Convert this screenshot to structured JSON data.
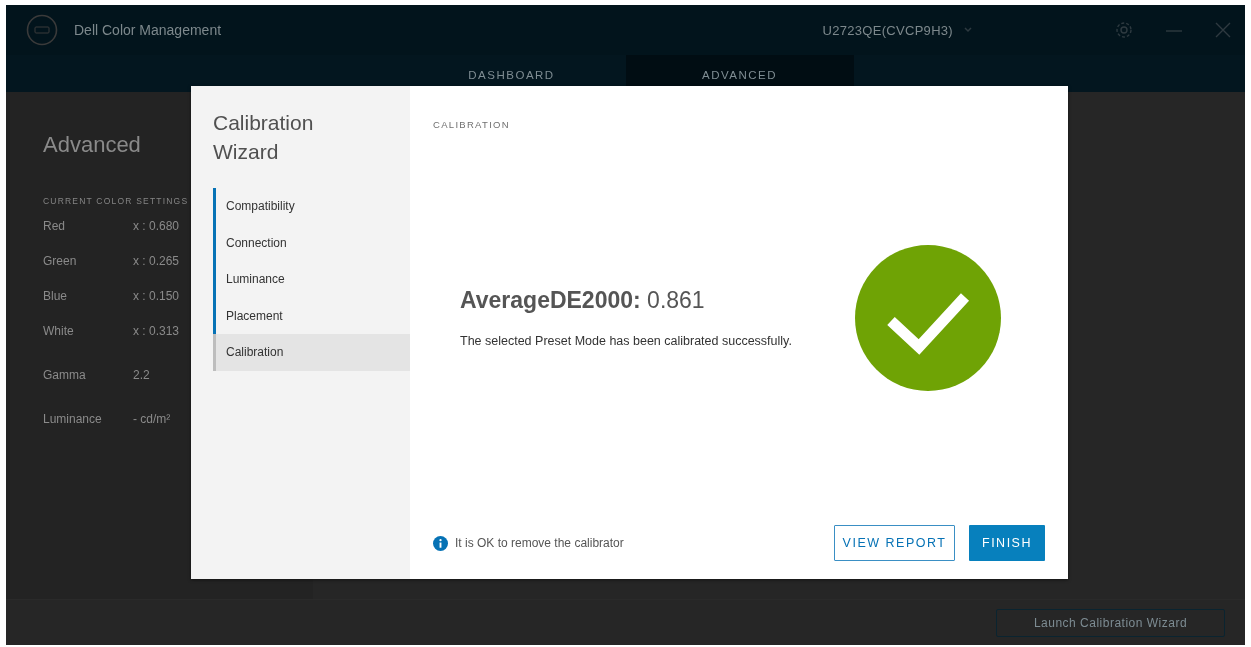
{
  "window": {
    "title": "Dell Color Management",
    "monitor": "U2723QE(CVCP9H3)"
  },
  "tabs": [
    {
      "label": "DASHBOARD",
      "selected": false
    },
    {
      "label": "ADVANCED",
      "selected": true
    }
  ],
  "advanced": {
    "title": "Advanced",
    "section": "CURRENT COLOR SETTINGS",
    "rows": [
      {
        "label": "Red",
        "value": "x : 0.680"
      },
      {
        "label": "Green",
        "value": "x : 0.265"
      },
      {
        "label": "Blue",
        "value": "x : 0.150"
      },
      {
        "label": "White",
        "value": "x : 0.313"
      },
      {
        "label": "Gamma",
        "value": "2.2"
      },
      {
        "label": "Luminance",
        "value": "- cd/m²"
      }
    ],
    "launch_button": "Launch Calibration Wizard"
  },
  "dialog": {
    "title": "Calibration Wizard",
    "steps": [
      {
        "label": "Compatibility",
        "completed": true,
        "selected": false
      },
      {
        "label": "Connection",
        "completed": true,
        "selected": false
      },
      {
        "label": "Luminance",
        "completed": true,
        "selected": false
      },
      {
        "label": "Placement",
        "completed": true,
        "selected": false
      },
      {
        "label": "Calibration",
        "completed": false,
        "selected": true
      }
    ],
    "section": "CALIBRATION",
    "result": "**AverageDE2000:** 0.861",
    "message": "The selected Preset Mode has been calibrated successfully.",
    "success": true,
    "note": "It is OK to remove the calibrator",
    "buttons": [
      {
        "label": "VIEW REPORT",
        "kind": "outline"
      },
      {
        "label": "FINISH",
        "kind": "primary"
      }
    ]
  }
}
